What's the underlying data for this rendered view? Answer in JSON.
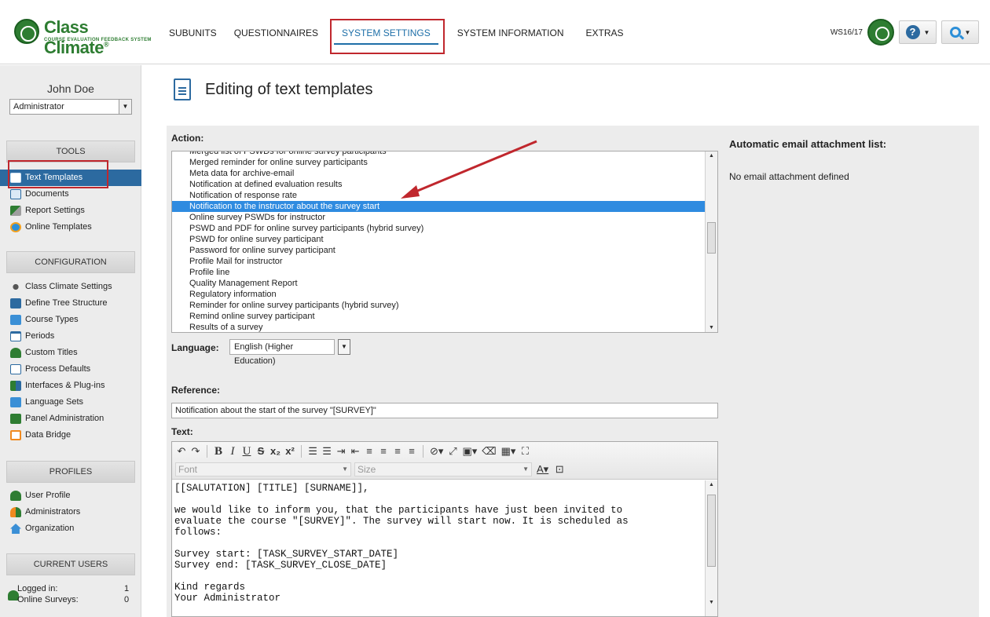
{
  "app": {
    "logo_title": "Class Climate",
    "logo_trademark": "®",
    "logo_subtitle": "COURSE EVALUATION FEEDBACK SYSTEM",
    "brand_color": "#2e7d32",
    "accent_color": "#2c6aa0",
    "highlight_color": "#c0272d"
  },
  "nav": {
    "items": [
      {
        "label": "SUBUNITS"
      },
      {
        "label": "QUESTIONNAIRES"
      },
      {
        "label": "SYSTEM SETTINGS",
        "active": true
      },
      {
        "label": "SYSTEM INFORMATION"
      },
      {
        "label": "EXTRAS"
      }
    ]
  },
  "top_right": {
    "semester": "WS16/17",
    "help_icon": "help-icon",
    "search_icon": "search-icon"
  },
  "sidebar": {
    "user_name": "John Doe",
    "role": "Administrator",
    "tools": {
      "header": "TOOLS",
      "items": [
        {
          "label": "Text Templates",
          "icon": "document-icon",
          "active": true
        },
        {
          "label": "Documents",
          "icon": "documents-icon"
        },
        {
          "label": "Report Settings",
          "icon": "report-icon"
        },
        {
          "label": "Online Templates",
          "icon": "globe-icon"
        }
      ]
    },
    "configuration": {
      "header": "CONFIGURATION",
      "items": [
        {
          "label": "Class Climate Settings",
          "icon": "gears-icon"
        },
        {
          "label": "Define Tree Structure",
          "icon": "tree-icon"
        },
        {
          "label": "Course Types",
          "icon": "folder-icon"
        },
        {
          "label": "Periods",
          "icon": "calendar-icon"
        },
        {
          "label": "Custom Titles",
          "icon": "person-icon"
        },
        {
          "label": "Process Defaults",
          "icon": "document-icon"
        },
        {
          "label": "Interfaces & Plug-ins",
          "icon": "plugin-icon"
        },
        {
          "label": "Language Sets",
          "icon": "flag-icon"
        },
        {
          "label": "Panel Administration",
          "icon": "panel-icon"
        },
        {
          "label": "Data Bridge",
          "icon": "bridge-icon"
        }
      ]
    },
    "profiles": {
      "header": "PROFILES",
      "items": [
        {
          "label": "User Profile",
          "icon": "user-icon"
        },
        {
          "label": "Administrators",
          "icon": "admins-icon"
        },
        {
          "label": "Organization",
          "icon": "home-icon"
        }
      ]
    },
    "current_users": {
      "header": "CURRENT USERS",
      "logged_in_label": "Logged in:",
      "logged_in_value": "1",
      "online_surveys_label": "Online Surveys:",
      "online_surveys_value": "0"
    }
  },
  "main": {
    "title": "Editing of text templates",
    "action_label": "Action:",
    "action_options": [
      "Merged list of PSWDs for online survey participants",
      "Merged reminder for online survey participants",
      "Meta data for archive-email",
      "Notification at defined evaluation results",
      "Notification of response rate",
      "Notification to the instructor about the survey start",
      "Online survey PSWDs for instructor",
      "PSWD and PDF for online survey participants (hybrid survey)",
      "PSWD for online survey participant",
      "Password for online survey participant",
      "Profile Mail for instructor",
      "Profile line",
      "Quality Management Report",
      "Regulatory information",
      "Reminder for online survey participants (hybrid survey)",
      "Remind online survey participant",
      "Results of a survey"
    ],
    "selected_action": "Notification to the instructor about the survey start",
    "language_label": "Language:",
    "language_value": "English (Higher Education)",
    "reference_label": "Reference:",
    "reference_value": "Notification about the start of the survey \"[SURVEY]\"",
    "text_label": "Text:",
    "font_placeholder": "Font",
    "size_placeholder": "Size",
    "text_body": "[[SALUTATION] [TITLE] [SURNAME]],\n\nwe would like to inform you, that the participants have just been invited to\nevaluate the course \"[SURVEY]\". The survey will start now. It is scheduled as\nfollows:\n\nSurvey start: [TASK_SURVEY_START_DATE]\nSurvey end: [TASK_SURVEY_CLOSE_DATE]\n\nKind regards\nYour Administrator"
  },
  "attachments": {
    "title": "Automatic email attachment list:",
    "empty_text": "No email attachment defined"
  }
}
